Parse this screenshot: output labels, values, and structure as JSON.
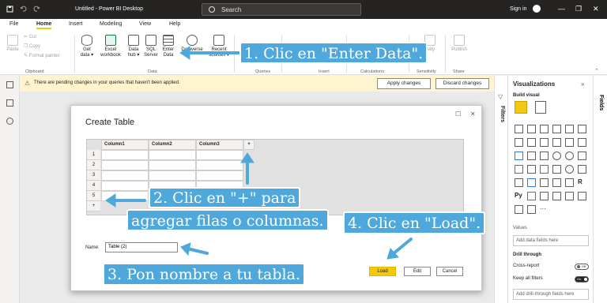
{
  "app": {
    "title": "Untitled - Power BI Desktop",
    "search_placeholder": "Search",
    "sign_in": "Sign in",
    "window_controls": [
      "—",
      "❐",
      "✕"
    ]
  },
  "menu": [
    "File",
    "Home",
    "Insert",
    "Modeling",
    "View",
    "Help"
  ],
  "ribbon": {
    "clipboard": {
      "paste": "Paste",
      "cut": "Cut",
      "copy": "Copy",
      "format_painter": "Format painter",
      "group": "Clipboard"
    },
    "data": {
      "get_data": [
        "Get",
        "data ▾"
      ],
      "excel": [
        "Excel",
        "workbook"
      ],
      "data_hub": [
        "Data",
        "hub ▾"
      ],
      "sql": [
        "SQL",
        "Server"
      ],
      "enter_data": [
        "Enter",
        "Data"
      ],
      "dataverse": "Dataverse",
      "recent": [
        "Recent",
        "sources ▾"
      ],
      "group": "Data"
    },
    "queries_group": "Queries",
    "insert_group": "Insert",
    "calculations_group": "Calculations",
    "sensitivity": {
      "label": "Sensitivity",
      "partial": "tivity"
    },
    "share": {
      "publish": "Publish",
      "group": "Share"
    }
  },
  "warning": {
    "text": "There are pending changes in your queries that haven't been applied.",
    "apply": "Apply changes",
    "discard": "Discard changes"
  },
  "filters_label": "Filters",
  "visualizations": {
    "title": "Visualizations",
    "build_visual": "Build visual",
    "values_label": "Values",
    "values_placeholder": "Add data fields here",
    "drill_through": "Drill through",
    "cross_report": "Cross-report",
    "cross_report_state": "Off",
    "keep_all_filters": "Keep all filters",
    "keep_all_filters_state": "On",
    "drill_placeholder": "Add drill-through fields here",
    "icon_text": [
      "R",
      "Py"
    ]
  },
  "fields_label": "Fields",
  "dialog": {
    "title": "Create Table",
    "columns": [
      "Column1",
      "Column2",
      "Column3"
    ],
    "add_column": "+",
    "rows": [
      "1",
      "2",
      "3",
      "4",
      "5"
    ],
    "add_row": "+",
    "name_label": "Name:",
    "name_value": "Table (2)",
    "load": "Load",
    "edit": "Edit",
    "cancel": "Cancel"
  },
  "callouts": {
    "c1": "1. Clic en \"Enter Data\".",
    "c2a": "2. Clic en \"+\" para",
    "c2b": "agregar filas o columnas.",
    "c3": "3. Pon nombre a tu tabla.",
    "c4": "4. Clic en \"Load\"."
  },
  "colors": {
    "accent": "#f2c811",
    "callout": "#4fa8dc",
    "titlebar": "#252423",
    "warning": "#fff4ce"
  }
}
